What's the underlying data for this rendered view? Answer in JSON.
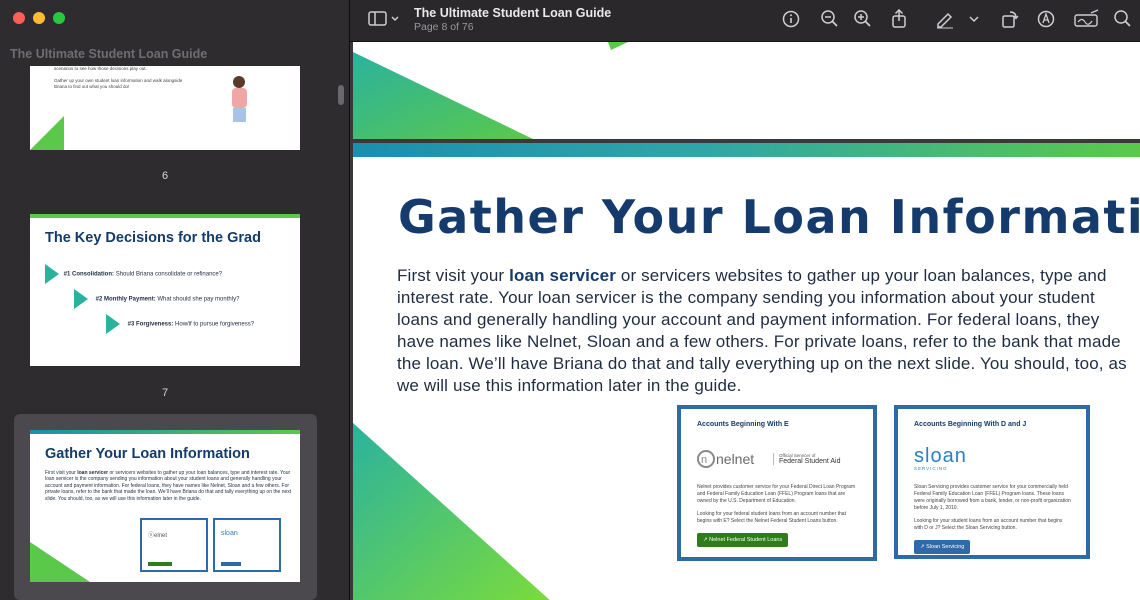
{
  "window": {
    "controls": [
      "close",
      "minimize",
      "zoom"
    ]
  },
  "sidebar": {
    "title": "The Ultimate Student Loan Guide",
    "thumbnails": [
      {
        "page": "6",
        "text_line1": "scenarios to see how those decisions play out.",
        "text_line2": "Gather up your own student loan information and walk alongside",
        "text_line3": "Briana to find out what you should do!"
      },
      {
        "page": "7",
        "heading": "The Key Decisions for the Grad",
        "items": [
          {
            "label": "#1 Consolidation:",
            "text": "Should Briana consolidate or refinance?"
          },
          {
            "label": "#2  Monthly Payment:",
            "text": "What should she pay monthly?"
          },
          {
            "label": "#3 Forgiveness:",
            "text": "How/if to pursue forgiveness?"
          }
        ]
      },
      {
        "page": "8",
        "heading": "Gather Your Loan Information",
        "selected": true
      }
    ]
  },
  "toolbar": {
    "title": "The Ultimate Student Loan Guide",
    "subtitle": "Page 8 of 76",
    "icons": [
      "sidebar-toggle-icon",
      "info-icon",
      "zoom-out-icon",
      "zoom-in-icon",
      "share-icon",
      "markup-pen-icon",
      "rotate-icon",
      "annotate-icon",
      "signature-icon",
      "search-icon"
    ]
  },
  "page": {
    "heading": "Gather Your Loan Information",
    "body_pre": "First visit your ",
    "body_bold": "loan servicer",
    "body_post": " or servicers websites to gather up your loan balances, type and interest rate. Your loan servicer is the company sending you information about your student loans and generally handling your account and payment information. For federal loans, they have names like Nelnet, Sloan and a few others. For private loans, refer to the bank that made the loan. We’ll have Briana do that and tally everything up on the next slide. You should, too, as we will use this information later in the guide.",
    "cards": [
      {
        "heading": "Accounts Beginning With E",
        "logo": "nelnet",
        "logo_sub": "Official Servicer of",
        "logo_sub2": "Federal Student Aid",
        "text": "Nelnet provides customer service for your Federal Direct Loan Program and Federal Family Education Loan (FFEL) Program loans that are owned by the U.S. Department of Education.",
        "text2": "Looking for your federal student loans from an account number that begins with E? Select the Nelnet Federal Student Loans button.",
        "button": "Nelnet Federal Student Loans"
      },
      {
        "heading": "Accounts Beginning With D and J",
        "logo": "sloan",
        "logo_sub": "SERVICING",
        "text": "Sloan Servicing provides customer service for your commercially held Federal Family Education Loan (FFEL) Program loans. These loans were originally borrowed from a bank, lender, or non-profit organization before July 1, 2010.",
        "text2": "Looking for your student loans from an account number that begins with D or J? Select the Sloan Servicing button.",
        "button": "Sloan Servicing"
      }
    ]
  },
  "colors": {
    "brand_navy": "#143b6b",
    "green": "#5ac94a",
    "teal": "#1a8fae"
  }
}
